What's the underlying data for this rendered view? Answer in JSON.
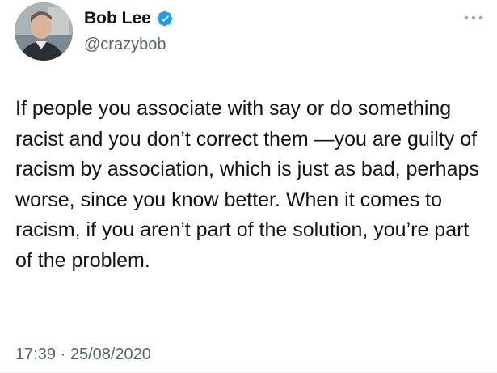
{
  "author": {
    "display_name": "Bob Lee",
    "handle": "@crazybob",
    "verified": true,
    "avatar_icon": "profile-photo",
    "verified_icon": "verified-badge-icon",
    "verified_color": "#1d9bf0"
  },
  "tweet": {
    "text": "If people you associate with say or do something racist and you don’t correct them —you are guilty of racism by association, which is just as bad, perhaps worse, since you know better. When it comes to racism, if you aren’t part of the solution, you’re part of the problem.",
    "timestamp": "17:39 · 25/08/2020"
  },
  "menu": {
    "more_icon": "more-horizontal-icon"
  },
  "colors": {
    "text_primary": "#0f1419",
    "text_secondary": "#536471",
    "background": "#ffffff"
  }
}
